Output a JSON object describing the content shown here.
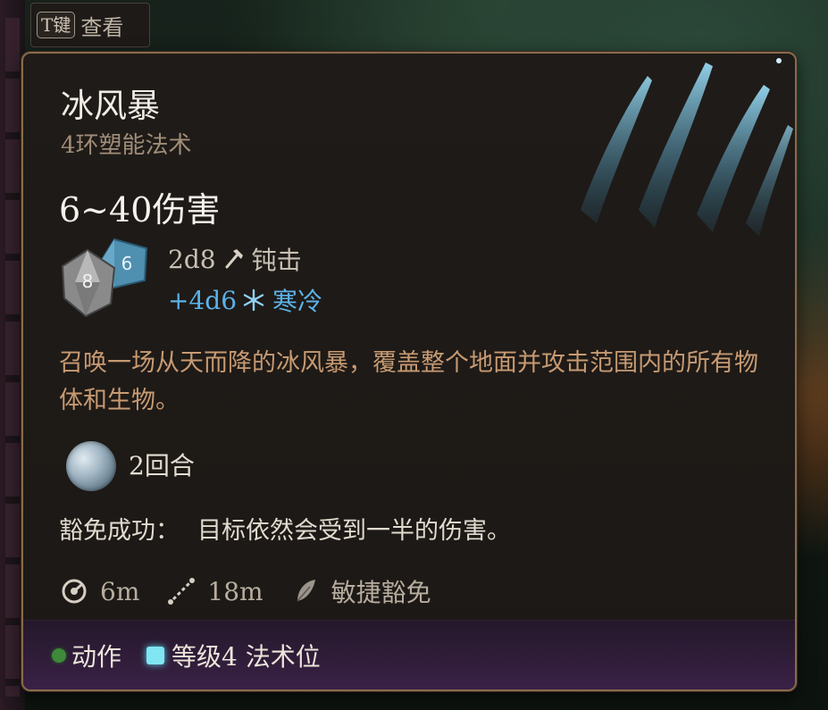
{
  "hint": {
    "key": "T键",
    "label": "查看"
  },
  "spell": {
    "name": "冰风暴",
    "school": "4环塑能法术",
    "damage_total": "6~40伤害",
    "damage": [
      {
        "dice": "2d8",
        "type": "钝击",
        "icon": "hammer-icon",
        "color": "#c9c1b4"
      },
      {
        "dice": "+4d6",
        "type": "寒冷",
        "icon": "snowflake-icon",
        "color": "#5bb2e8"
      }
    ],
    "dice_faces": {
      "d8": "8",
      "d6": "6"
    },
    "description": "召唤一场从天而降的冰风暴，覆盖整个地面并攻击范围内的所有物体和生物。",
    "duration": "2回合",
    "save_label": "豁免成功：",
    "save_text": "目标依然会受到一半的伤害。",
    "radius": "6m",
    "range": "18m",
    "save_type": "敏捷豁免"
  },
  "footer": {
    "action": "动作",
    "slot": "等级4 法术位"
  },
  "colors": {
    "cold": "#5bb2e8",
    "border": "#8a6a4c",
    "description": "#c79a72",
    "action_dot": "#3d8a3a",
    "slot_square": "#7fe6f2"
  }
}
